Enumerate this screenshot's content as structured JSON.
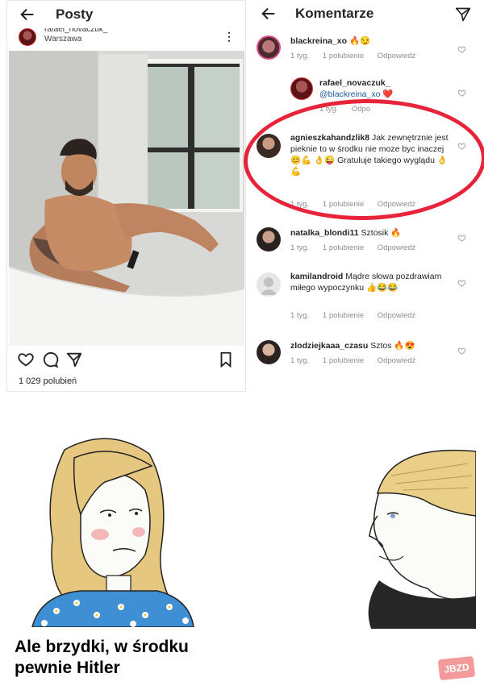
{
  "left": {
    "title": "Posty",
    "post_user": "rafael_novaczuk_",
    "post_location": "Warszawa",
    "more_icon": "more-vertical-icon",
    "likes": "1 029 polubień"
  },
  "right": {
    "title": "Komentarze",
    "comments": [
      {
        "user": "blackreina_xo",
        "text": "🔥😏",
        "time": "1 tyg.",
        "likes": "1 polubienie",
        "reply": "Odpowiedź"
      },
      {
        "user": "rafael_novaczuk_",
        "mention": "@blackreina_xo",
        "text": "❤️",
        "time": "1 tyg.",
        "likes": "",
        "reply": "Odpo"
      },
      {
        "user": "agnieszkahandzlik8",
        "text": "Jak zewnętrznie jest pieknie to w środku nie moze byc  inaczej 😊💪 👌😜 Gratuluje takiego wyglądu 👌 💪",
        "time": "1 tyg.",
        "likes": "1 polubienie",
        "reply": "Odpowiedź"
      },
      {
        "user": "natalka_blondi11",
        "text": "Sztosik 🔥",
        "time": "1 tyg.",
        "likes": "1 polubienie",
        "reply": "Odpowiedź"
      },
      {
        "user": "kamilandroid",
        "text": "Mądre słowa pozdrawiam miłego wypoczynku 👍😂😂",
        "time": "1 tyg.",
        "likes": "1 polubienie",
        "reply": "Odpowiedź"
      },
      {
        "user": "zlodziejkaaa_czasu",
        "text": "Sztos 🔥😍",
        "time": "1 tyg.",
        "likes": "1 polubienie",
        "reply": "Odpowiedź"
      }
    ]
  },
  "meme": {
    "caption_line1": "Ale brzydki, w środku",
    "caption_line2": "pewnie Hitler",
    "watermark": "JBZD"
  },
  "colors": {
    "highlight": "#e8243a",
    "mention": "#1b5a9b",
    "meta": "#8e8e8e"
  }
}
